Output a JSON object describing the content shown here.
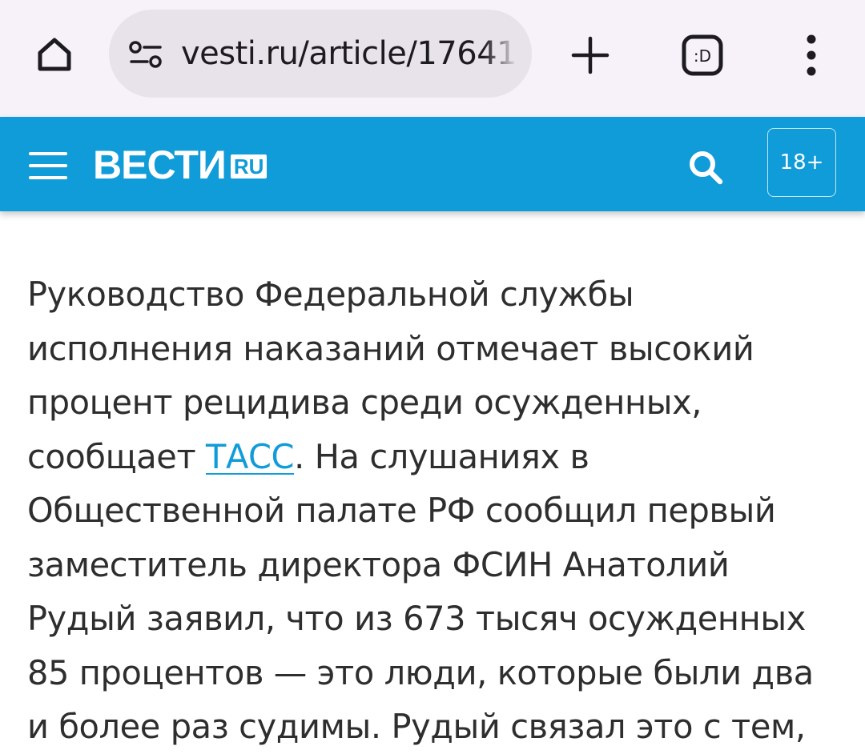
{
  "browser": {
    "url": "vesti.ru/article/17641",
    "icons": {
      "home": "home-icon",
      "site_settings": "tune-icon",
      "new_tab": "plus-icon",
      "tab_switcher": "tab-switcher-icon",
      "menu": "more-vert-icon"
    },
    "tab_switcher_label": ":D"
  },
  "site": {
    "logo_text": "ВЕСТИ",
    "logo_badge": "RU",
    "age_rating": "18+",
    "brand_color": "#109bd9",
    "icons": {
      "menu": "hamburger-icon",
      "search": "search-icon"
    }
  },
  "article": {
    "lines": [
      {
        "text": "Руководство Федеральной службы"
      },
      {
        "text": "исполнения наказаний отмечает высокий"
      },
      {
        "text": "процент рецидива среди осужденных,"
      },
      {
        "before": "сообщает ",
        "link": "ТАСС",
        "after": ". На слушаниях в"
      },
      {
        "text": "Общественной палате РФ сообщил первый"
      },
      {
        "text": "заместитель директора ФСИН Анатолий"
      },
      {
        "text": "Рудый заявил, что из 673 тысяч осужденных"
      },
      {
        "text": "85 процентов — это люди, которые были два"
      },
      {
        "text": "и более раз судимы. Рудый связал это с тем,"
      }
    ]
  }
}
